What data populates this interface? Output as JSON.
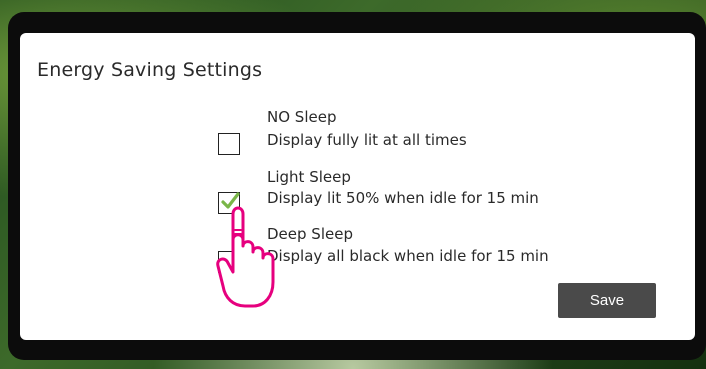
{
  "dialog": {
    "title": "Energy Saving Settings",
    "options": [
      {
        "name": "NO Sleep",
        "description": "Display fully lit at all times",
        "checked": false
      },
      {
        "name": "Light Sleep",
        "description": "Display lit 50% when idle for 15 min",
        "checked": true
      },
      {
        "name": "Deep Sleep",
        "description": "Display all black when idle for 15 min",
        "checked": false
      }
    ],
    "save_label": "Save"
  },
  "colors": {
    "check_green": "#7ab648",
    "hand_pink": "#e6007e",
    "button_bg": "#4a4a4a"
  },
  "icons": {
    "check": "checkmark-icon",
    "pointer": "hand-pointer-icon"
  }
}
